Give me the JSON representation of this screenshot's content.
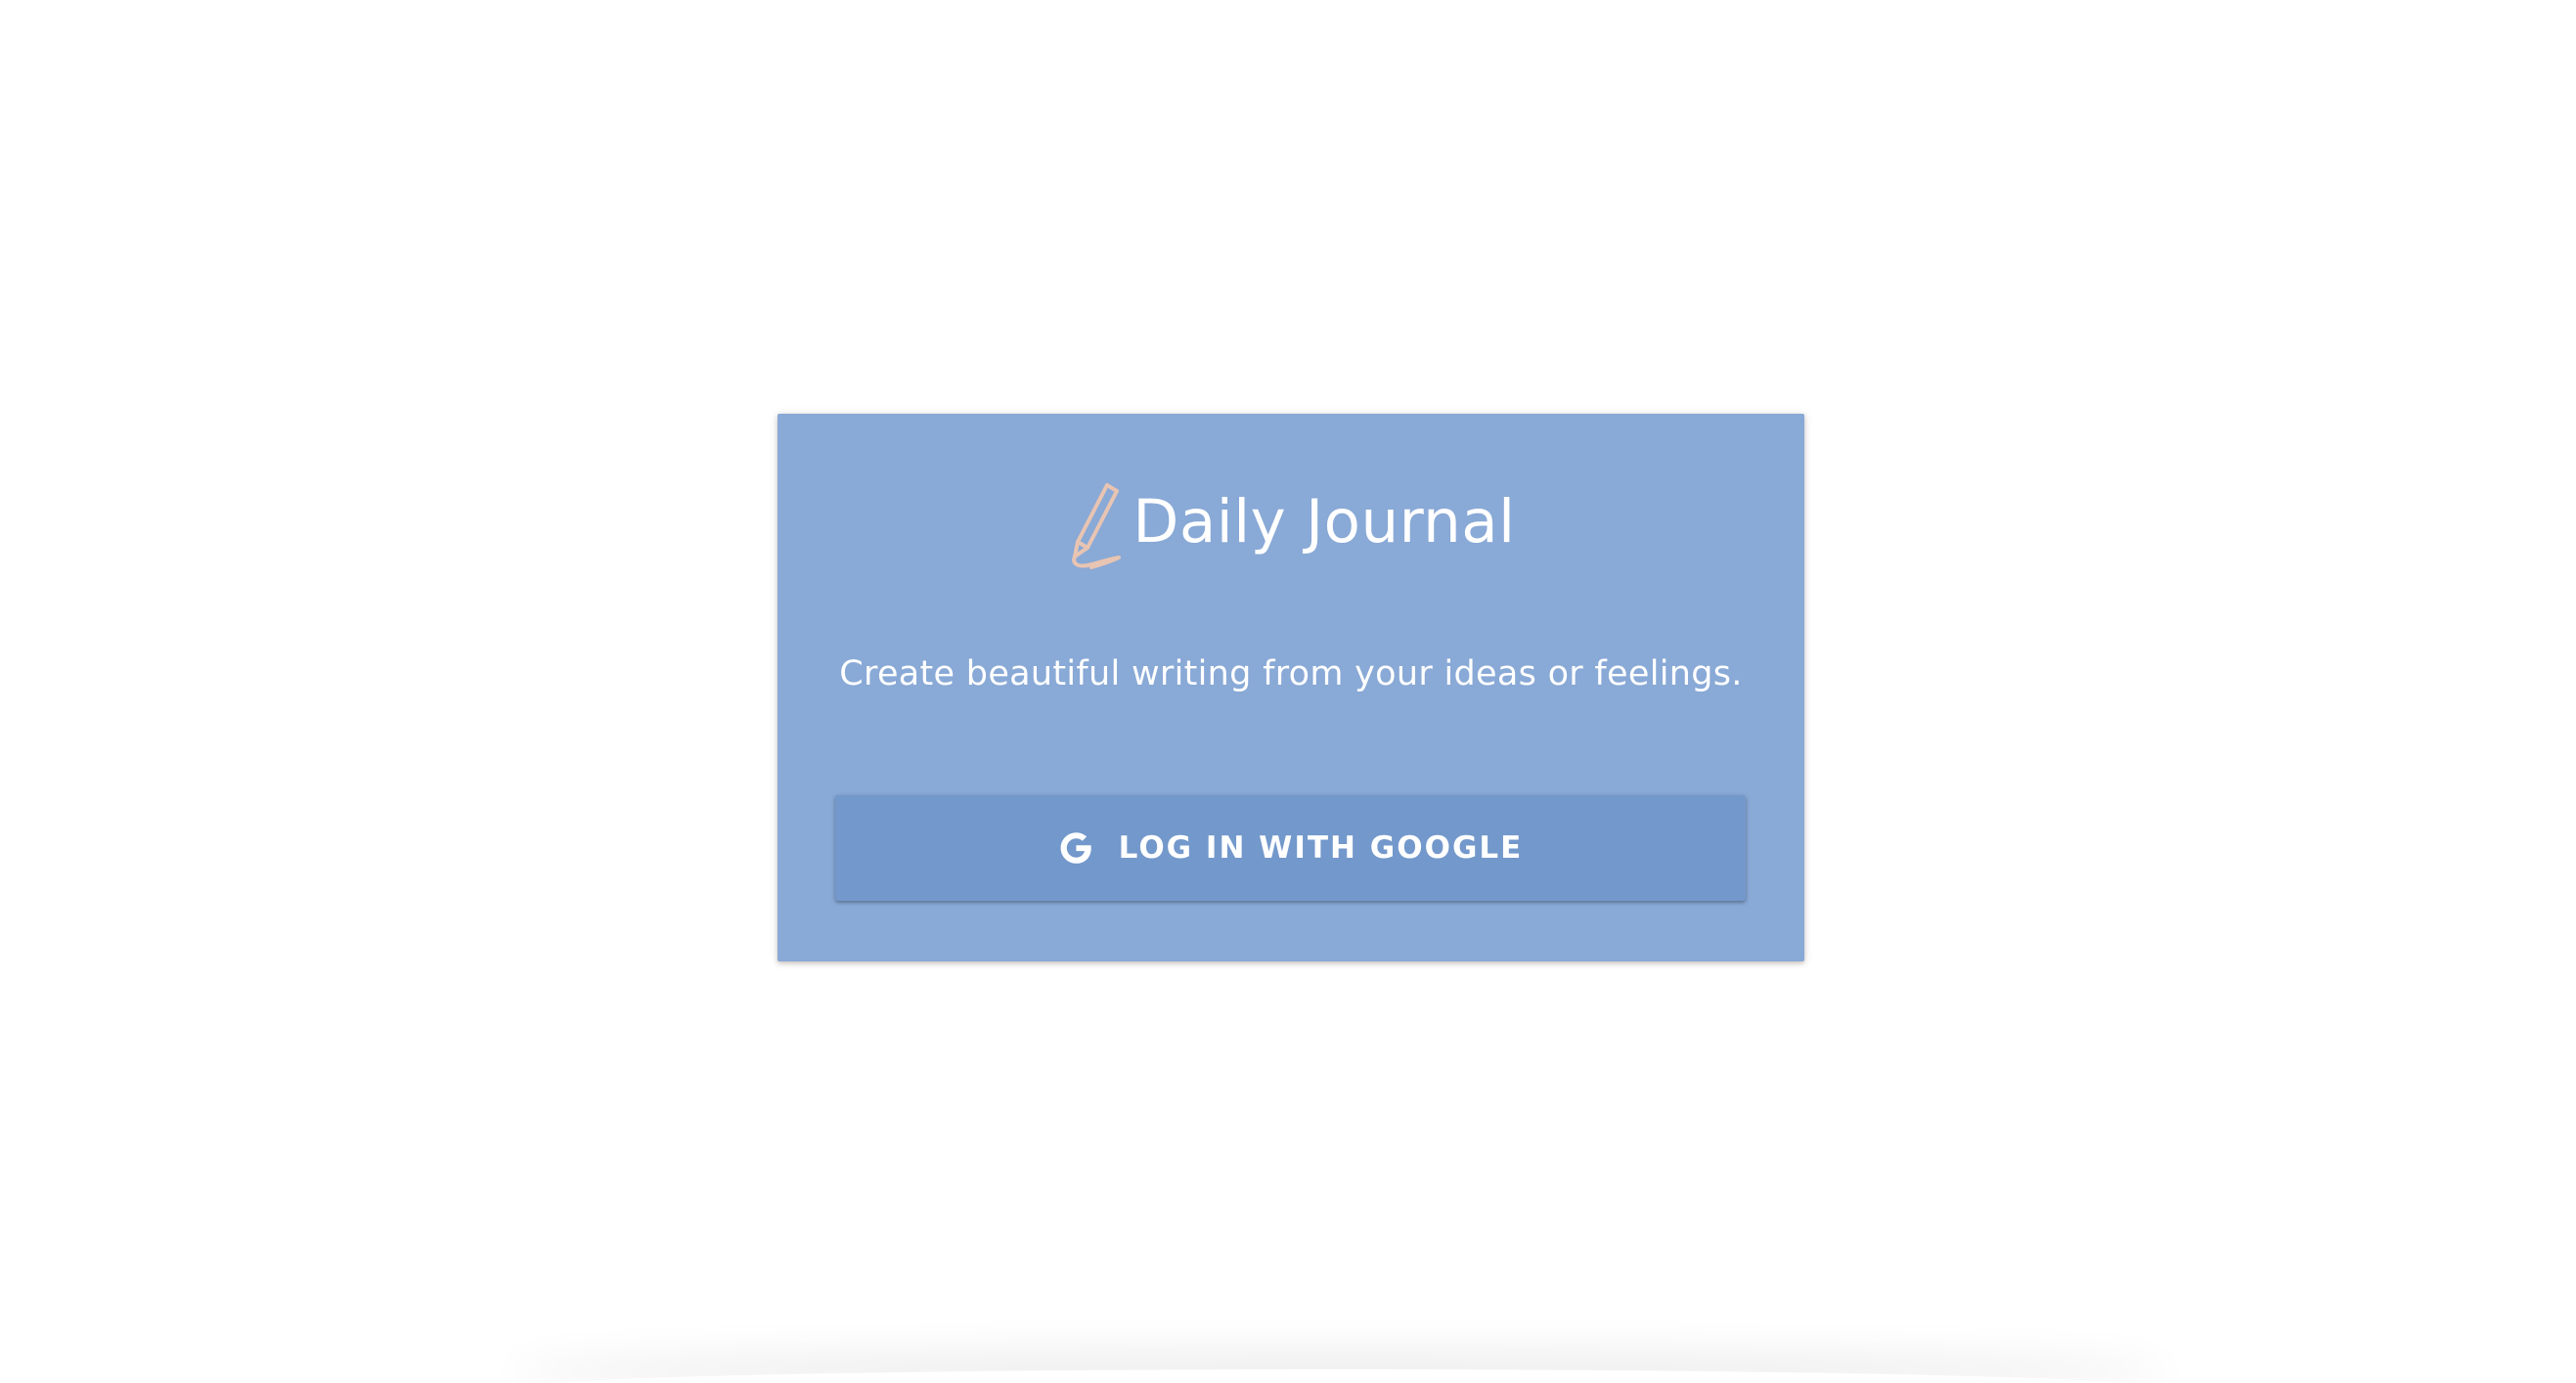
{
  "app": {
    "title": "Daily Journal",
    "tagline": "Create beautiful writing from your ideas or feelings."
  },
  "login": {
    "button_label": "LOG IN WITH GOOGLE"
  },
  "icons": {
    "brand": "pencil-icon",
    "login": "google-icon"
  },
  "colors": {
    "card_background": "#89a9d6",
    "button_background": "#7398cb",
    "brand_icon": "#e8c4b2",
    "text": "#ffffff",
    "page_background": "#ffffff"
  }
}
